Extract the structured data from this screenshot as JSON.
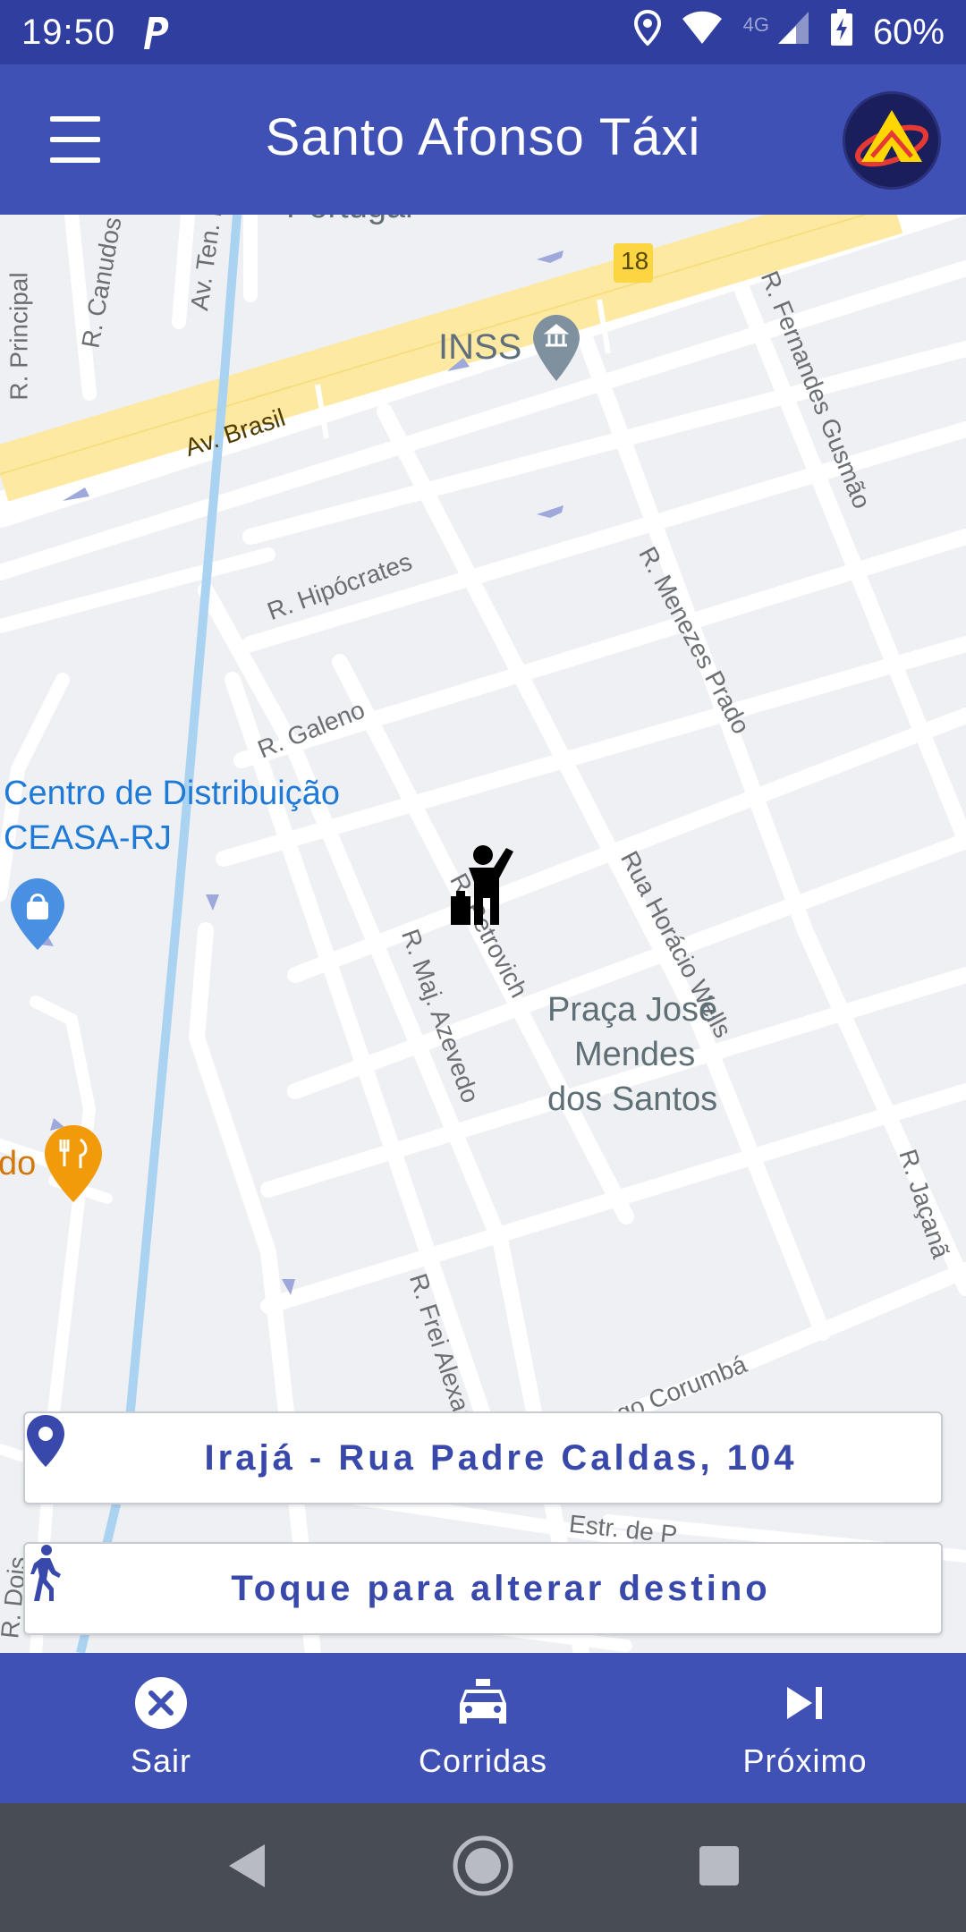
{
  "status_bar": {
    "time": "19:50",
    "network": "4G",
    "battery": "60%",
    "icons": [
      "parking-icon",
      "location-icon",
      "wifi-icon",
      "signal-icon",
      "battery-icon"
    ]
  },
  "app_bar": {
    "title": "Santo Afonso Táxi",
    "menu_icon": "menu-icon",
    "logo": "app-logo"
  },
  "map": {
    "highway_shield": "18",
    "poi_inss": "INSS",
    "poi_portugal": "Portugal",
    "poi_ceasa_line1": "Centro de Distribuição",
    "poi_ceasa_line2": "CEASA-RJ",
    "poi_restaurant": "do",
    "praca_line1": "Praça José",
    "praca_line2": "Mendes",
    "praca_line3": "dos Santos",
    "streets": {
      "av_brasil": "Av. Brasil",
      "r_principal": "R. Principal",
      "r_canudos": "R. Canudos",
      "av_ten": "Av. Ten. F",
      "r_fernandes": "R. Fernandes Gusmão",
      "r_hipocrates": "R. Hipócrates",
      "r_galeno": "R. Galeno",
      "r_menezes": "R. Menezes Prado",
      "r_petrovich": "R. Petrovich",
      "rua_horacio": "Rua Horácio Wells",
      "r_maj_azevedo": "R. Maj. Azevedo",
      "r_frei": "R. Frei Alexand",
      "r_jacana": "R. Jaçanã",
      "r_corumba": "ngo Corumbá",
      "estr": "Estr. de P",
      "r_dois": "R. Dois"
    },
    "marker_icon": "passenger-hailing-icon"
  },
  "pickup_card": {
    "icon": "location-pin-icon",
    "text": "Irajá - Rua Padre Caldas, 104"
  },
  "destination_card": {
    "icon": "walking-person-icon",
    "text": "Toque para alterar destino"
  },
  "bottom_nav": {
    "items": [
      {
        "label": "Sair",
        "icon": "close-circle-icon"
      },
      {
        "label": "Corridas",
        "icon": "taxi-icon"
      },
      {
        "label": "Próximo",
        "icon": "skip-next-icon"
      }
    ]
  },
  "system_nav": {
    "back": "back-icon",
    "home": "home-icon",
    "recents": "recents-icon"
  },
  "colors": {
    "primary": "#3f51b5",
    "primary_dark": "#303f9f",
    "accent_text": "#3949ab",
    "highway": "#fde9a1",
    "water": "#aad3f2"
  }
}
